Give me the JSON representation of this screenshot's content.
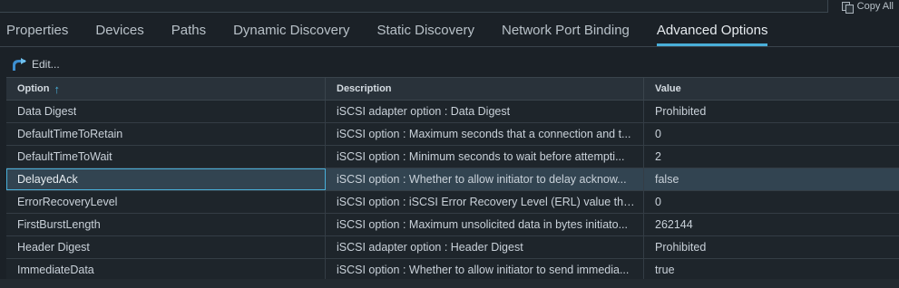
{
  "topbar": {
    "copy_all_label": "Copy All"
  },
  "tabs": [
    {
      "label": "Properties",
      "active": false
    },
    {
      "label": "Devices",
      "active": false
    },
    {
      "label": "Paths",
      "active": false
    },
    {
      "label": "Dynamic Discovery",
      "active": false
    },
    {
      "label": "Static Discovery",
      "active": false
    },
    {
      "label": "Network Port Binding",
      "active": false
    },
    {
      "label": "Advanced Options",
      "active": true
    }
  ],
  "toolbar": {
    "edit_label": "Edit..."
  },
  "table": {
    "headers": {
      "option": "Option",
      "description": "Description",
      "value": "Value"
    },
    "sort": "ascending",
    "rows": [
      {
        "option": "Data Digest",
        "description": "iSCSI adapter option : Data Digest",
        "value": "Prohibited",
        "selected": false
      },
      {
        "option": "DefaultTimeToRetain",
        "description": "iSCSI option : Maximum seconds that a connection and t...",
        "value": "0",
        "selected": false
      },
      {
        "option": "DefaultTimeToWait",
        "description": "iSCSI option : Minimum seconds to wait before attempti...",
        "value": "2",
        "selected": false
      },
      {
        "option": "DelayedAck",
        "description": "iSCSI option : Whether to allow initiator to delay acknow...",
        "value": "false",
        "selected": true
      },
      {
        "option": "ErrorRecoveryLevel",
        "description": "iSCSI option : iSCSI Error Recovery Level (ERL) value tha...",
        "value": "0",
        "selected": false
      },
      {
        "option": "FirstBurstLength",
        "description": "iSCSI option : Maximum unsolicited data in bytes initiato...",
        "value": "262144",
        "selected": false
      },
      {
        "option": "Header Digest",
        "description": "iSCSI adapter option : Header Digest",
        "value": "Prohibited",
        "selected": false
      },
      {
        "option": "ImmediateData",
        "description": "iSCSI option : Whether to allow initiator to send immedia...",
        "value": "true",
        "selected": false
      }
    ]
  },
  "colors": {
    "accent": "#49afd9",
    "background": "#1b2127",
    "selected_row": "#324451"
  }
}
